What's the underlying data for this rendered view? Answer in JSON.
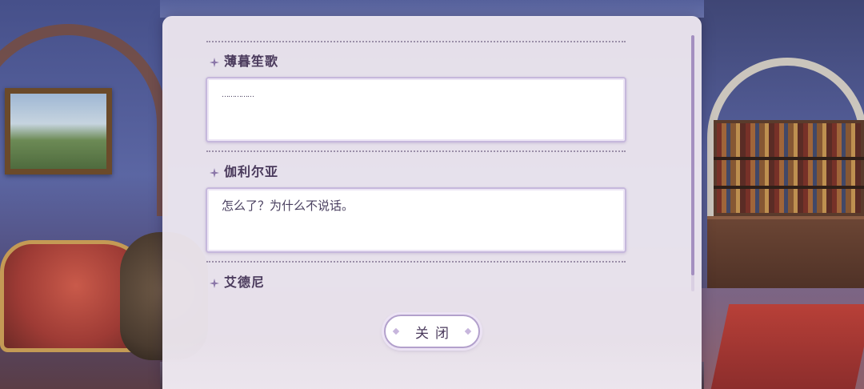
{
  "log": {
    "entries": [
      {
        "speaker": "薄暮笙歌",
        "text": "……………"
      },
      {
        "speaker": "伽利尔亚",
        "text": "怎么了？为什么不说话。"
      },
      {
        "speaker": "艾德尼",
        "text": ""
      }
    ]
  },
  "controls": {
    "close_label": "关闭"
  },
  "colors": {
    "panel_bg": "#eee8f0",
    "accent_purple": "#a48fc0",
    "name_text": "#4a3a5c",
    "message_text": "#4a4060"
  },
  "icons": {
    "speaker_marker": "sparkle-icon"
  }
}
